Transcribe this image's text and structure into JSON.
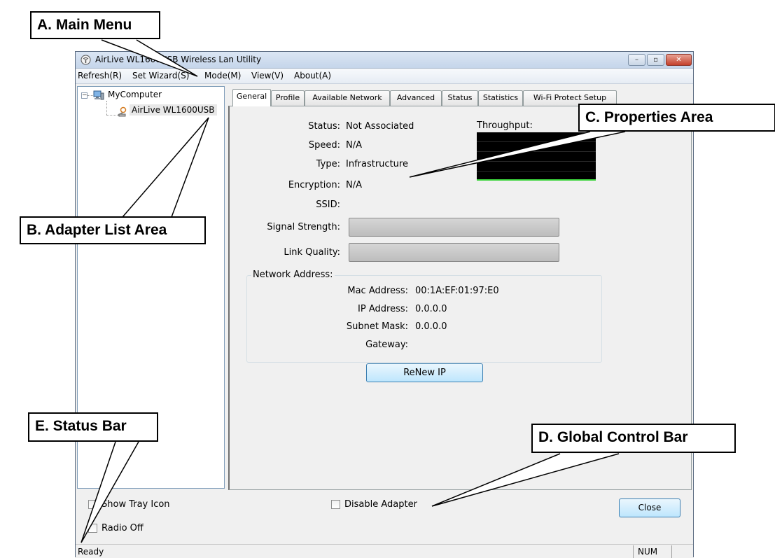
{
  "window": {
    "title": "AirLive WL1600USB Wireless Lan Utility",
    "controls": {
      "minimize": "–",
      "maximize": "▫",
      "close": "✕"
    }
  },
  "menu": [
    "Refresh(R)",
    "Set Wizard(S)",
    "Mode(M)",
    "View(V)",
    "About(A)"
  ],
  "tree": {
    "expander": "−",
    "root": "MyComputer",
    "child": "AirLive WL1600USB"
  },
  "tabs": [
    "General",
    "Profile",
    "Available Network",
    "Advanced",
    "Status",
    "Statistics",
    "Wi-Fi Protect Setup"
  ],
  "general": {
    "status_label": "Status:",
    "status_value": "Not Associated",
    "speed_label": "Speed:",
    "speed_value": "N/A",
    "type_label": "Type:",
    "type_value": "Infrastructure",
    "encryption_label": "Encryption:",
    "encryption_value": "N/A",
    "ssid_label": "SSID:",
    "ssid_value": "",
    "signal_label": "Signal Strength:",
    "signal_level": 0,
    "link_label": "Link Quality:",
    "link_level": 0,
    "throughput_label": "Throughput:"
  },
  "network_address": {
    "title": "Network Address:",
    "mac_label": "Mac Address:",
    "mac_value": "00:1A:EF:01:97:E0",
    "ip_label": "IP Address:",
    "ip_value": "0.0.0.0",
    "subnet_label": "Subnet Mask:",
    "subnet_value": "0.0.0.0",
    "gateway_label": "Gateway:",
    "gateway_value": ""
  },
  "renew_button": "ReNew IP",
  "control_bar": {
    "show_tray": "Show Tray Icon",
    "radio_off": "Radio Off",
    "disable_adapter": "Disable Adapter",
    "close": "Close"
  },
  "status_bar": {
    "text": "Ready",
    "num": "NUM"
  },
  "callouts": {
    "a": "A. Main Menu",
    "b": "B. Adapter List Area",
    "c": "C. Properties Area",
    "d": "D. Global Control Bar",
    "e": "E. Status Bar"
  },
  "colors": {
    "graph_background": "#000000",
    "graph_line": "#3bd43b",
    "close_button": "#c4402a"
  }
}
